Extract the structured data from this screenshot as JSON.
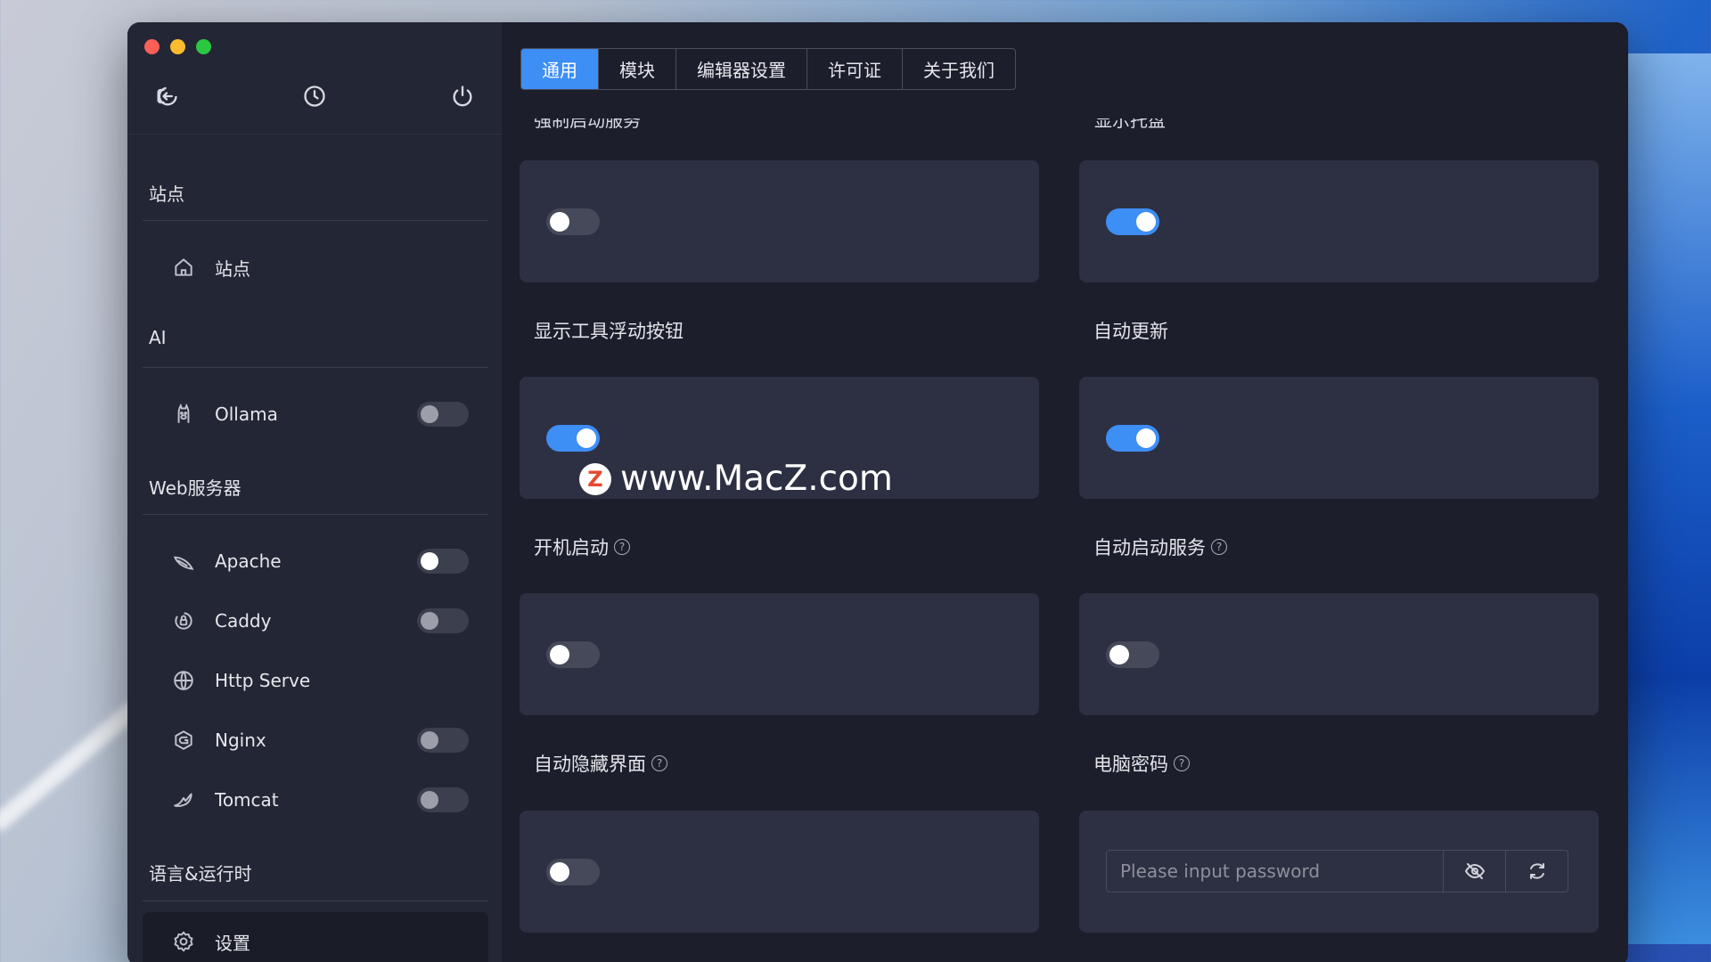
{
  "sidebar": {
    "sections": {
      "sites": "站点",
      "ai": "AI",
      "web": "Web服务器",
      "lang": "语言&运行时"
    },
    "items": {
      "sites": "站点",
      "ollama": "Ollama",
      "apache": "Apache",
      "caddy": "Caddy",
      "http_serve": "Http Serve",
      "nginx": "Nginx",
      "tomcat": "Tomcat",
      "settings": "设置"
    }
  },
  "tabs": [
    "通用",
    "模块",
    "编辑器设置",
    "许可证",
    "关于我们"
  ],
  "settings": {
    "cut_left": "强制启动服务",
    "cut_right": "显示托盘",
    "float_button": "显示工具浮动按钮",
    "auto_update": "自动更新",
    "boot_start": "开机启动",
    "auto_start_services": "自动启动服务",
    "auto_hide": "自动隐藏界面",
    "computer_password": "电脑密码",
    "help_mark": "?"
  },
  "password": {
    "placeholder": "Please input password"
  },
  "watermark": {
    "logo": "Z",
    "text": "www.MacZ.com"
  },
  "toggle_states": {
    "ollama": false,
    "apache": false,
    "caddy": false,
    "nginx": false,
    "tomcat": false,
    "cut_left": false,
    "cut_right": true,
    "float_button": true,
    "auto_update": true,
    "boot_start": false,
    "auto_start_services": false,
    "auto_hide": false
  },
  "colors": {
    "accent": "#3d8ef5",
    "window_bg": "#1c1e2c",
    "sidebar_bg": "#232634",
    "card_bg": "#2d3042"
  }
}
